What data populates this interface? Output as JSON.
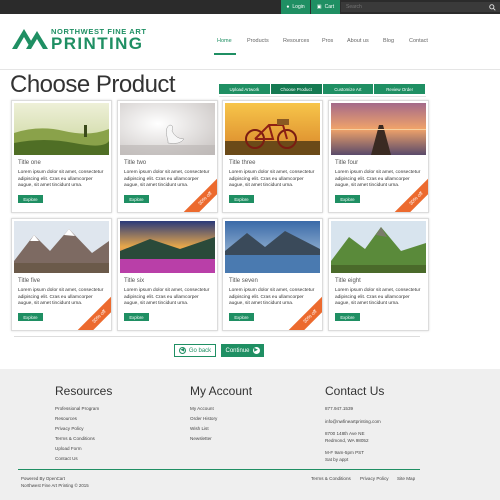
{
  "topbar": {
    "login_label": "Login",
    "cart_label": "Cart",
    "search_placeholder": "Search"
  },
  "header": {
    "logo_top": "NORTHWEST FINE ART",
    "logo_main": "PRINTING",
    "nav": [
      "Home",
      "Products",
      "Resources",
      "Pros",
      "About us",
      "Blog",
      "Contact"
    ],
    "active_nav": "Home"
  },
  "page": {
    "title": "Choose Product",
    "steps": [
      "Upload Artwork",
      "Choose Product",
      "Customize Art",
      "Review Order"
    ],
    "current_step": "Choose Product"
  },
  "products": [
    {
      "title": "Title one",
      "desc": "Lorem ipsum dolor sit amet, consectetur adipiscing elit. Cras eu ullamcorper augue, sit amet tincidunt urna.",
      "button": "Explore",
      "ribbon": ""
    },
    {
      "title": "Title two",
      "desc": "Lorem ipsum dolor sit amet, consectetur adipiscing elit. Cras eu ullamcorper augue, sit amet tincidunt urna.",
      "button": "Explore",
      "ribbon": "30% off"
    },
    {
      "title": "Title three",
      "desc": "Lorem ipsum dolor sit amet, consectetur adipiscing elit. Cras eu ullamcorper augue, sit amet tincidunt urna.",
      "button": "Explore",
      "ribbon": ""
    },
    {
      "title": "Title four",
      "desc": "Lorem ipsum dolor sit amet, consectetur adipiscing elit. Cras eu ullamcorper augue, sit amet tincidunt urna.",
      "button": "Explore",
      "ribbon": "30% off"
    },
    {
      "title": "Title five",
      "desc": "Lorem ipsum dolor sit amet, consectetur adipiscing elit. Cras eu ullamcorper augue, sit amet tincidunt urna.",
      "button": "Explore",
      "ribbon": "30% off"
    },
    {
      "title": "Title six",
      "desc": "Lorem ipsum dolor sit amet, consectetur adipiscing elit. Cras eu ullamcorper augue, sit amet tincidunt urna.",
      "button": "Explore",
      "ribbon": ""
    },
    {
      "title": "Title seven",
      "desc": "Lorem ipsum dolor sit amet, consectetur adipiscing elit. Cras eu ullamcorper augue, sit amet tincidunt urna.",
      "button": "Explore",
      "ribbon": "30% off"
    },
    {
      "title": "Title eight",
      "desc": "Lorem ipsum dolor sit amet, consectetur adipiscing elit. Cras eu ullamcorper augue, sit amet tincidunt urna.",
      "button": "Explore",
      "ribbon": ""
    }
  ],
  "actions": {
    "back_label": "Go back",
    "continue_label": "Continue"
  },
  "footer": {
    "resources_heading": "Resources",
    "resources_links": [
      "Professional Program",
      "Resources",
      "Privacy Policy",
      "Terms & Conditions",
      "Upload Form",
      "Contact Us"
    ],
    "account_heading": "My Account",
    "account_links": [
      "My Account",
      "Order History",
      "Wish List",
      "Newsletter"
    ],
    "contact_heading": "Contact Us",
    "phone": "877.947.1539",
    "email": "info@nwfineartprinting.com",
    "address_line1": "8700 148th Ave NE",
    "address_line2": "Redmond, WA 98052",
    "hours_line1": "M-F 9am-5pm PST",
    "hours_line2": "Sat by appt",
    "powered_by": "Powered By OpenCart",
    "copyright": "Northwest Fine Art Printing © 2015",
    "bottom_links": [
      "Terms & Conditions",
      "Privacy Policy",
      "Site Map"
    ]
  },
  "colors": {
    "brand_green": "#1f8f63",
    "ribbon_orange": "#ec6a2e",
    "topbar": "#2b2b2b",
    "footer_bg": "#efefef"
  }
}
